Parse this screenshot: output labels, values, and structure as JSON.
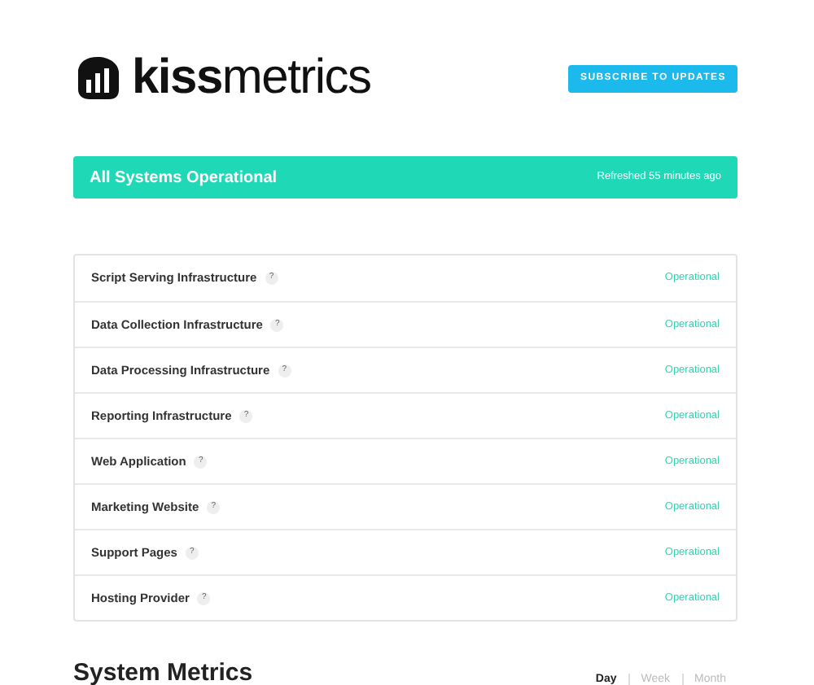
{
  "header": {
    "logo": {
      "bold": "kiss",
      "light": "metrics"
    },
    "subscribe_button": "SUBSCRIBE TO UPDATES"
  },
  "banner": {
    "title": "All Systems Operational",
    "refreshed": "Refreshed 55 minutes ago"
  },
  "components": [
    {
      "name": "Script Serving Infrastructure",
      "help": "?",
      "status": "Operational"
    },
    {
      "name": "Data Collection Infrastructure",
      "help": "?",
      "status": "Operational"
    },
    {
      "name": "Data Processing Infrastructure",
      "help": "?",
      "status": "Operational"
    },
    {
      "name": "Reporting Infrastructure",
      "help": "?",
      "status": "Operational"
    },
    {
      "name": "Web Application",
      "help": "?",
      "status": "Operational"
    },
    {
      "name": "Marketing Website",
      "help": "?",
      "status": "Operational"
    },
    {
      "name": "Support Pages",
      "help": "?",
      "status": "Operational"
    },
    {
      "name": "Hosting Provider",
      "help": "?",
      "status": "Operational"
    }
  ],
  "metrics": {
    "title": "System Metrics",
    "tabs": [
      {
        "label": "Day",
        "selected": true
      },
      {
        "label": "Week",
        "selected": false
      },
      {
        "label": "Month",
        "selected": false
      }
    ]
  }
}
